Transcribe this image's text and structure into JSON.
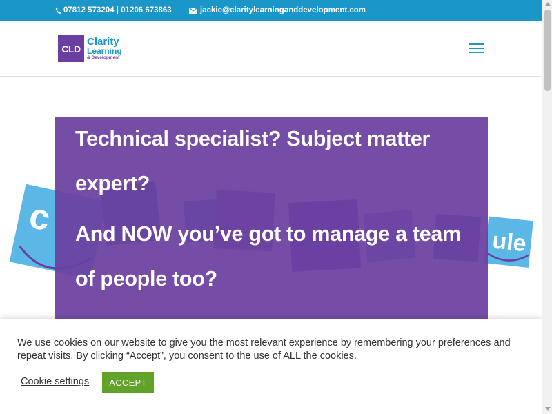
{
  "topbar": {
    "phone": "07812 573204 | 01206 673863",
    "email": "jackie@claritylearninganddevelopment.com",
    "phone_icon": "phone-icon",
    "email_icon": "envelope-icon"
  },
  "header": {
    "logo_mark": "CLD",
    "logo_line1": "Clarity",
    "logo_line2": "Learning",
    "logo_line3": "& Development",
    "menu_icon": "hamburger-icon"
  },
  "hero": {
    "line1": "Technical specialist? Subject matter",
    "line2": "expert?",
    "line3": "And NOW you’ve got to manage a team",
    "line4": "of people too?"
  },
  "cookie": {
    "text": "We use cookies on our website to give you the most relevant experience by remembering your preferences and repeat visits. By clicking “Accept”, you consent to the use of ALL the cookies.",
    "settings_label": "Cookie settings",
    "accept_label": "ACCEPT"
  },
  "colors": {
    "brand_blue": "#1a96c8",
    "brand_purple": "#6b3fa0",
    "accept_green": "#61a229"
  }
}
